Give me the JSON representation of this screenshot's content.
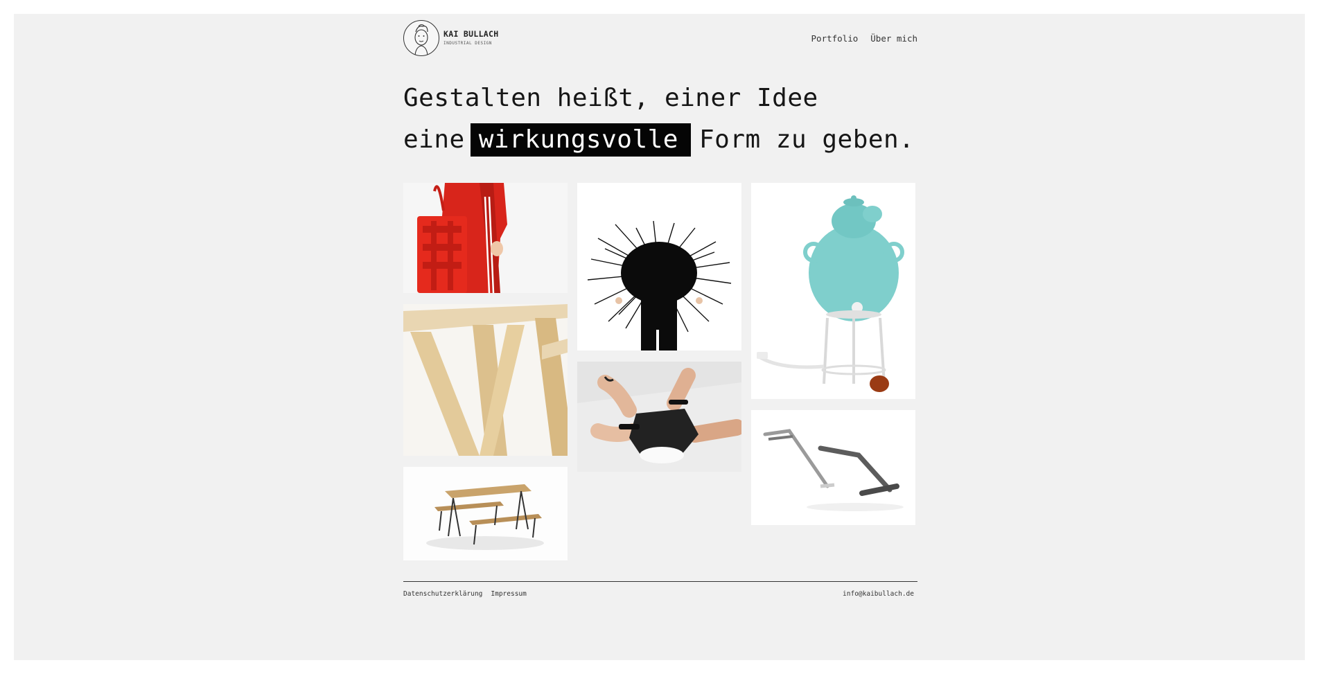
{
  "header": {
    "brand_name": "KAI BULLACH",
    "brand_sub": "INDUSTRIAL DESIGN",
    "nav": [
      "Portfolio",
      "Über mich"
    ]
  },
  "headline": {
    "line1": "Gestalten heißt, einer Idee",
    "line2_before": "eine",
    "line2_highlight": "wirkungsvolle",
    "line2_after": "Form zu geben."
  },
  "portfolio": {
    "tiles": [
      {
        "subject": "red-bag"
      },
      {
        "subject": "wooden-table-legs"
      },
      {
        "subject": "beer-bench-set"
      },
      {
        "subject": "brush-costume"
      },
      {
        "subject": "hands-with-device"
      },
      {
        "subject": "turquoise-samovar"
      },
      {
        "subject": "metal-stand"
      }
    ]
  },
  "footer": {
    "links": [
      "Datenschutzerklärung",
      "Impressum"
    ],
    "email": "info@kaibullach.de"
  },
  "colors": {
    "page_bg": "#f1f1f1",
    "highlight_bg": "#050505",
    "text": "#161616",
    "accent_red": "#d9261c",
    "accent_turquoise": "#7fcfcc"
  }
}
